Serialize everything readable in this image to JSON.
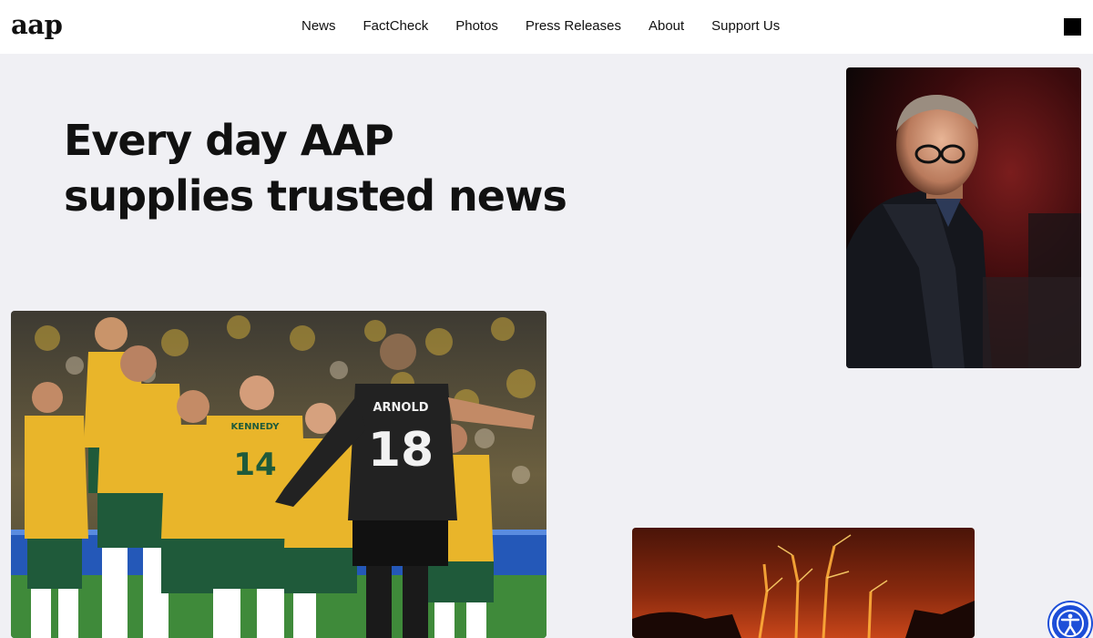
{
  "header": {
    "logo": "aap",
    "nav": [
      {
        "label": "News"
      },
      {
        "label": "FactCheck"
      },
      {
        "label": "Photos"
      },
      {
        "label": "Press Releases"
      },
      {
        "label": "About"
      },
      {
        "label": "Support Us"
      }
    ],
    "menu_icon": "square-menu-icon"
  },
  "hero": {
    "title_line1": "Every day AAP",
    "title_line2": "supplies trusted news"
  },
  "photos": {
    "politician": {
      "icon": "politician-photo",
      "jersey": ""
    },
    "football": {
      "icon": "football-celebration-photo",
      "jersey_name": "ARNOLD",
      "jersey_number": "18",
      "jersey_name2": "KENNEDY",
      "jersey_number2": "14"
    },
    "fire": {
      "icon": "bushfire-photo"
    }
  },
  "accessibility": {
    "icon": "accessibility-icon"
  },
  "colors": {
    "header_bg": "#ffffff",
    "page_bg": "#f0f0f4",
    "text": "#111111",
    "a11y_blue": "#1d4ed8",
    "matildas_gold": "#e9b52a",
    "matildas_green": "#1f5a3a"
  }
}
